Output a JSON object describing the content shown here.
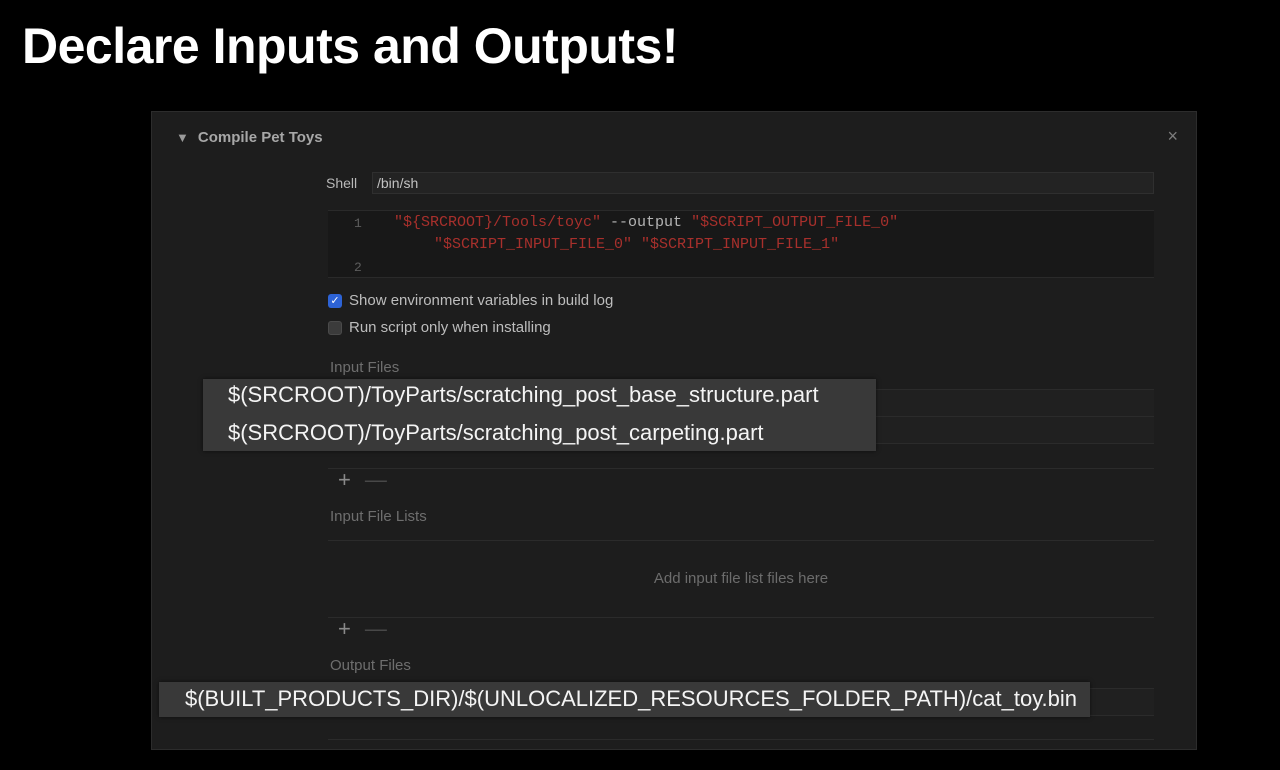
{
  "slide": {
    "title": "Declare Inputs and Outputs!"
  },
  "phase": {
    "title": "Compile Pet Toys",
    "close_glyph": "×"
  },
  "shell": {
    "label": "Shell",
    "value": "/bin/sh"
  },
  "script": {
    "line1_no": "1",
    "line2_no": "2",
    "tok1": "\"${SRCROOT}/Tools/toyc\"",
    "tok2": " --output ",
    "tok3": "\"$SCRIPT_OUTPUT_FILE_0\"",
    "tok4": "\"$SCRIPT_INPUT_FILE_0\" \"$SCRIPT_INPUT_FILE_1\""
  },
  "options": {
    "show_env": {
      "label": "Show environment variables in build log",
      "checked": true
    },
    "run_only_installing": {
      "label": "Run script only when installing",
      "checked": false
    }
  },
  "input_files": {
    "label": "Input Files",
    "items": [
      "$(SRCROOT)/ToyParts/scratching_post_base_structure.part",
      "$(SRCROOT)/ToyParts/scratching_post_carpeting.part"
    ]
  },
  "input_file_lists": {
    "label": "Input File Lists",
    "placeholder": "Add input file list files here"
  },
  "output_files": {
    "label": "Output Files",
    "items": [
      "$(BUILT_PRODUCTS_DIR)/$(UNLOCALIZED_RESOURCES_FOLDER_PATH)/cat_toy.bin"
    ]
  },
  "buttons": {
    "add": "+",
    "remove": "—"
  },
  "icons": {
    "disclosure": "disclosure-triangle-icon",
    "check": "checkmark-icon"
  },
  "colors": {
    "accent": "#2d63d6",
    "string": "#a8302c",
    "background": "#000000",
    "panel": "#1d1d1d"
  }
}
